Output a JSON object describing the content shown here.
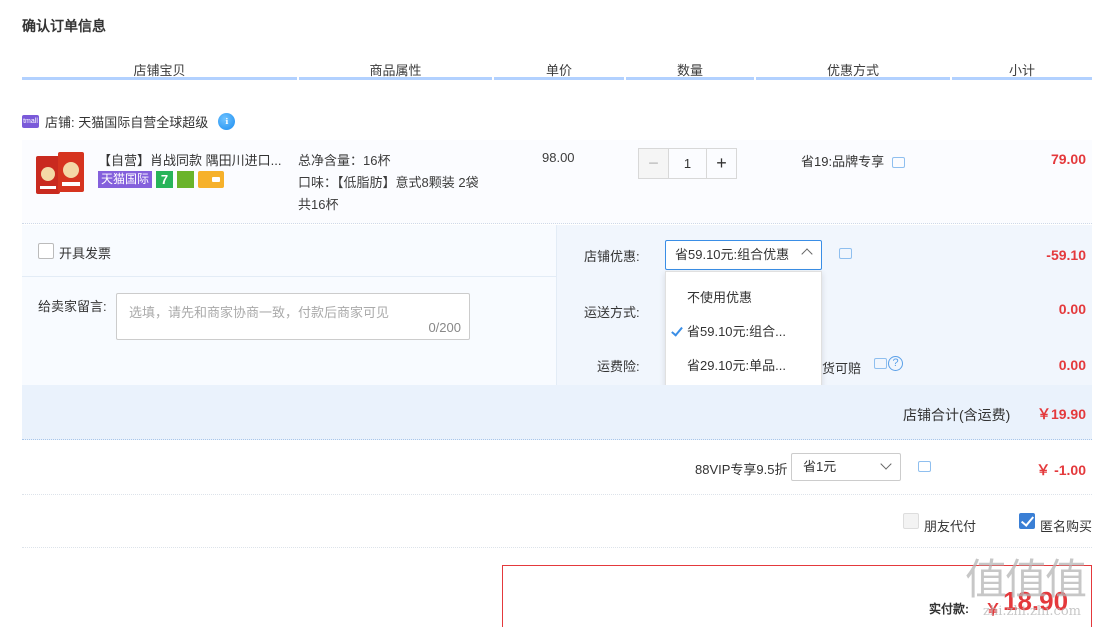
{
  "page_title": "确认订单信息",
  "columns": [
    "店铺宝贝",
    "商品属性",
    "单价",
    "数量",
    "优惠方式",
    "小计"
  ],
  "shop": {
    "label": "店铺: 天猫国际自营全球超级",
    "icon": "shop-icon",
    "ww_icon": "wangwang-icon",
    "ww_text": "ℹ"
  },
  "item": {
    "title": "【自营】肖战同款 隅田川进口...",
    "badge_tmall": "天猫国际",
    "badge_7": "7",
    "attr_line1": "总净含量：16杯",
    "attr_line2": "口味：【低脂肪】意式8颗装 2袋",
    "attr_line3": "共16杯",
    "unit_price": "98.00",
    "qty_minus": "−",
    "qty": "1",
    "qty_plus": "+",
    "promo": "省19:品牌专享",
    "subtotal": "79.00"
  },
  "options": {
    "invoice_label": "开具发票",
    "message_label": "给卖家留言:",
    "message_placeholder": "选填，请先和商家协商一致，付款后商家可见",
    "message_count": "0/200",
    "store_discount_label": "店铺优惠:",
    "store_discount_selected": "省59.10元:组合优惠",
    "store_discount_amount": "-59.10",
    "dropdown_items": [
      "不使用优惠",
      "省59.10元:组合...",
      "省29.10元:单品..."
    ],
    "shipping_label": "运送方式:",
    "shipping_amount": "0.00",
    "insurance_label": "运费险:",
    "insurance_text": "货可赔",
    "insurance_amount": "0.00",
    "help_icon": "?"
  },
  "shop_total": {
    "label": "店铺合计(含运费)",
    "amount": "￥19.90"
  },
  "vip": {
    "label": "88VIP专享9.5折",
    "selected": "省1元",
    "amount": "￥ -1.00"
  },
  "friend_pay": {
    "label": "朋友代付"
  },
  "anonymous": {
    "label": "匿名购买"
  },
  "payment": {
    "label": "实付款:",
    "currency": "￥",
    "amount": "18.90"
  },
  "watermark": {
    "text": "值值值",
    "url": "zhi.zhi.zhi.com"
  },
  "colors": {
    "accent": "#3a8ee6",
    "price_red": "#e4393c",
    "header_rule": "#b2d1ff"
  }
}
